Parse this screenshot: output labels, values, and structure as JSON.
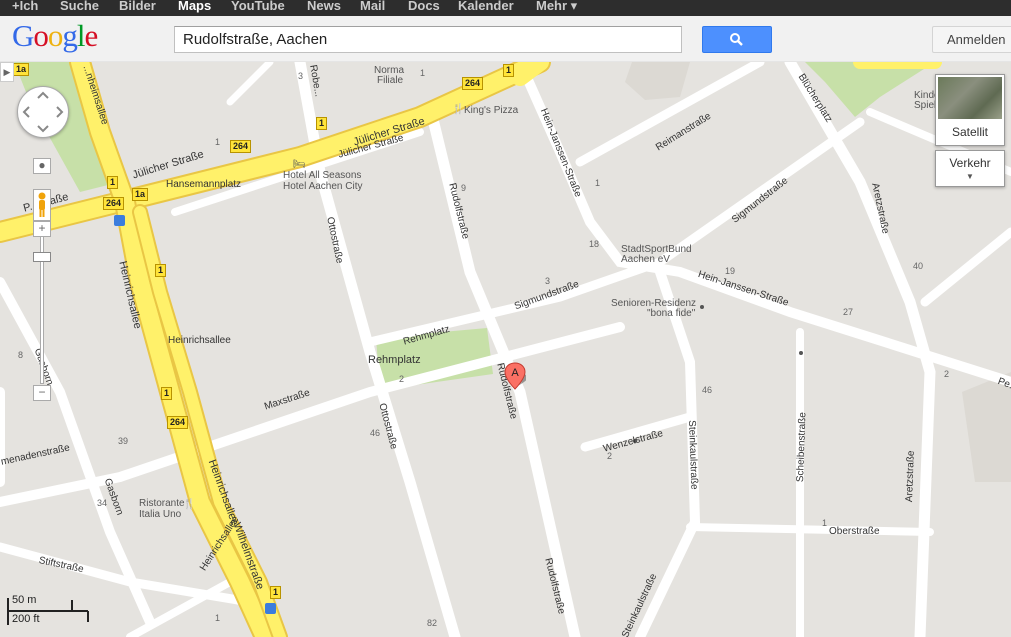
{
  "gbar": {
    "items": [
      "+Ich",
      "Suche",
      "Bilder",
      "Maps",
      "YouTube",
      "News",
      "Mail",
      "Docs",
      "Kalender",
      "Mehr ▾"
    ],
    "active": "Maps"
  },
  "header": {
    "search_value": "Rudolfstraße, Aachen",
    "signin_label": "Anmelden"
  },
  "controls": {
    "satellite_label": "Satellit",
    "traffic_label": "Verkehr",
    "scale_metric": "50 m",
    "scale_imperial": "200 ft",
    "zoom_in": "+",
    "zoom_out": "−"
  },
  "marker": {
    "letter": "A"
  },
  "map_labels": {
    "streets": {
      "juelicher_1": "Jülicher Straße",
      "juelicher_2": "Jülicher Straße",
      "juelicher_3": "Jülicher Straße",
      "promenade": "P...straße",
      "hansemannplatz": "Hansemannplatz",
      "heinrichsallee_1": "Heinrichsallee",
      "heinrichsallee_2": "Heinrichsallee",
      "heinrichsallee_3": "Heinrichsallee",
      "heinrichsallee_lbl": "Heinrichsallee",
      "wilhelmstrasse": "Wilhelmstraße",
      "ottostrasse_1": "Ottostraße",
      "ottostrasse_2": "Ottostraße",
      "rudolfstrasse_1": "Rudolfstraße",
      "rudolfstrasse_2": "Rudolfstraße",
      "rudolfstrasse_3": "Rudolfstraße",
      "rehmplatz_str": "Rehmplatz",
      "rehmplatz_park": "Rehmplatz",
      "sigmundstrasse_1": "Sigmundstraße",
      "sigmundstrasse_2": "Sigmundstraße",
      "maxstrasse": "Maxstraße",
      "wenzelstrasse": "Wenzelstraße",
      "steinkaulstrasse_1": "Steinkaulstraße",
      "steinkaulstrasse_2": "Steinkaulstraße",
      "scheibenstrasse": "Scheibenstraße",
      "oberstrasse": "Oberstraße",
      "aretzstrasse_1": "Aretzstraße",
      "aretzstrasse_2": "Aretzstraße",
      "hein_janssen_1": "Hein-Janssen-Straße",
      "hein_janssen_2": "Hein-Janssen-Straße",
      "reimanstrasse": "Reimanstraße",
      "bluecherplatz": "Blücherplatz",
      "gasborn_1": "Gasborn",
      "gasborn_2": "Gasborn",
      "stiftstrasse": "Stiftstraße",
      "promenadenstrasse": "menadenstraße",
      "kaiserallee": "...nheimsallee",
      "robert": "Robe...",
      "p_right": "Pe..."
    },
    "pois": {
      "norma": "Norma",
      "filiale": "Filiale",
      "kings_pizza": "King's Pizza",
      "hotel_1": "Hotel All Seasons",
      "hotel_2": "Hotel Aachen City",
      "sportbund_1": "StadtSportBund",
      "sportbund_2": "Aachen eV",
      "senioren_1": "Senioren-Residenz",
      "senioren_2": "\"bona fide\"",
      "ristorante_1": "Ristorante",
      "ristorante_2": "Italia Uno",
      "kinder_1": "Kinder",
      "kinder_2": "Spiel"
    },
    "shields": {
      "s264_a": "264",
      "s264_b": "264",
      "s264_c": "264",
      "s264_d": "264",
      "s1_a": "1",
      "s1_b": "1",
      "s1_c": "1",
      "s1_d": "1",
      "s1_e": "1",
      "s1_f": "1",
      "s1a_a": "1a",
      "s1a_b": "1a"
    },
    "house_numbers": [
      "3",
      "1",
      "1",
      "9",
      "18",
      "3",
      "19",
      "27",
      "40",
      "2",
      "2",
      "1",
      "46",
      "46",
      "39",
      "34",
      "2",
      "82",
      "1",
      "8",
      "1"
    ]
  },
  "colors": {
    "land": "#e5e3df",
    "road": "#ffffff",
    "major_road": "#fff16a",
    "major_road_casing": "#e9c645",
    "park": "#c7e0a8",
    "search_blue": "#4d90fe"
  }
}
